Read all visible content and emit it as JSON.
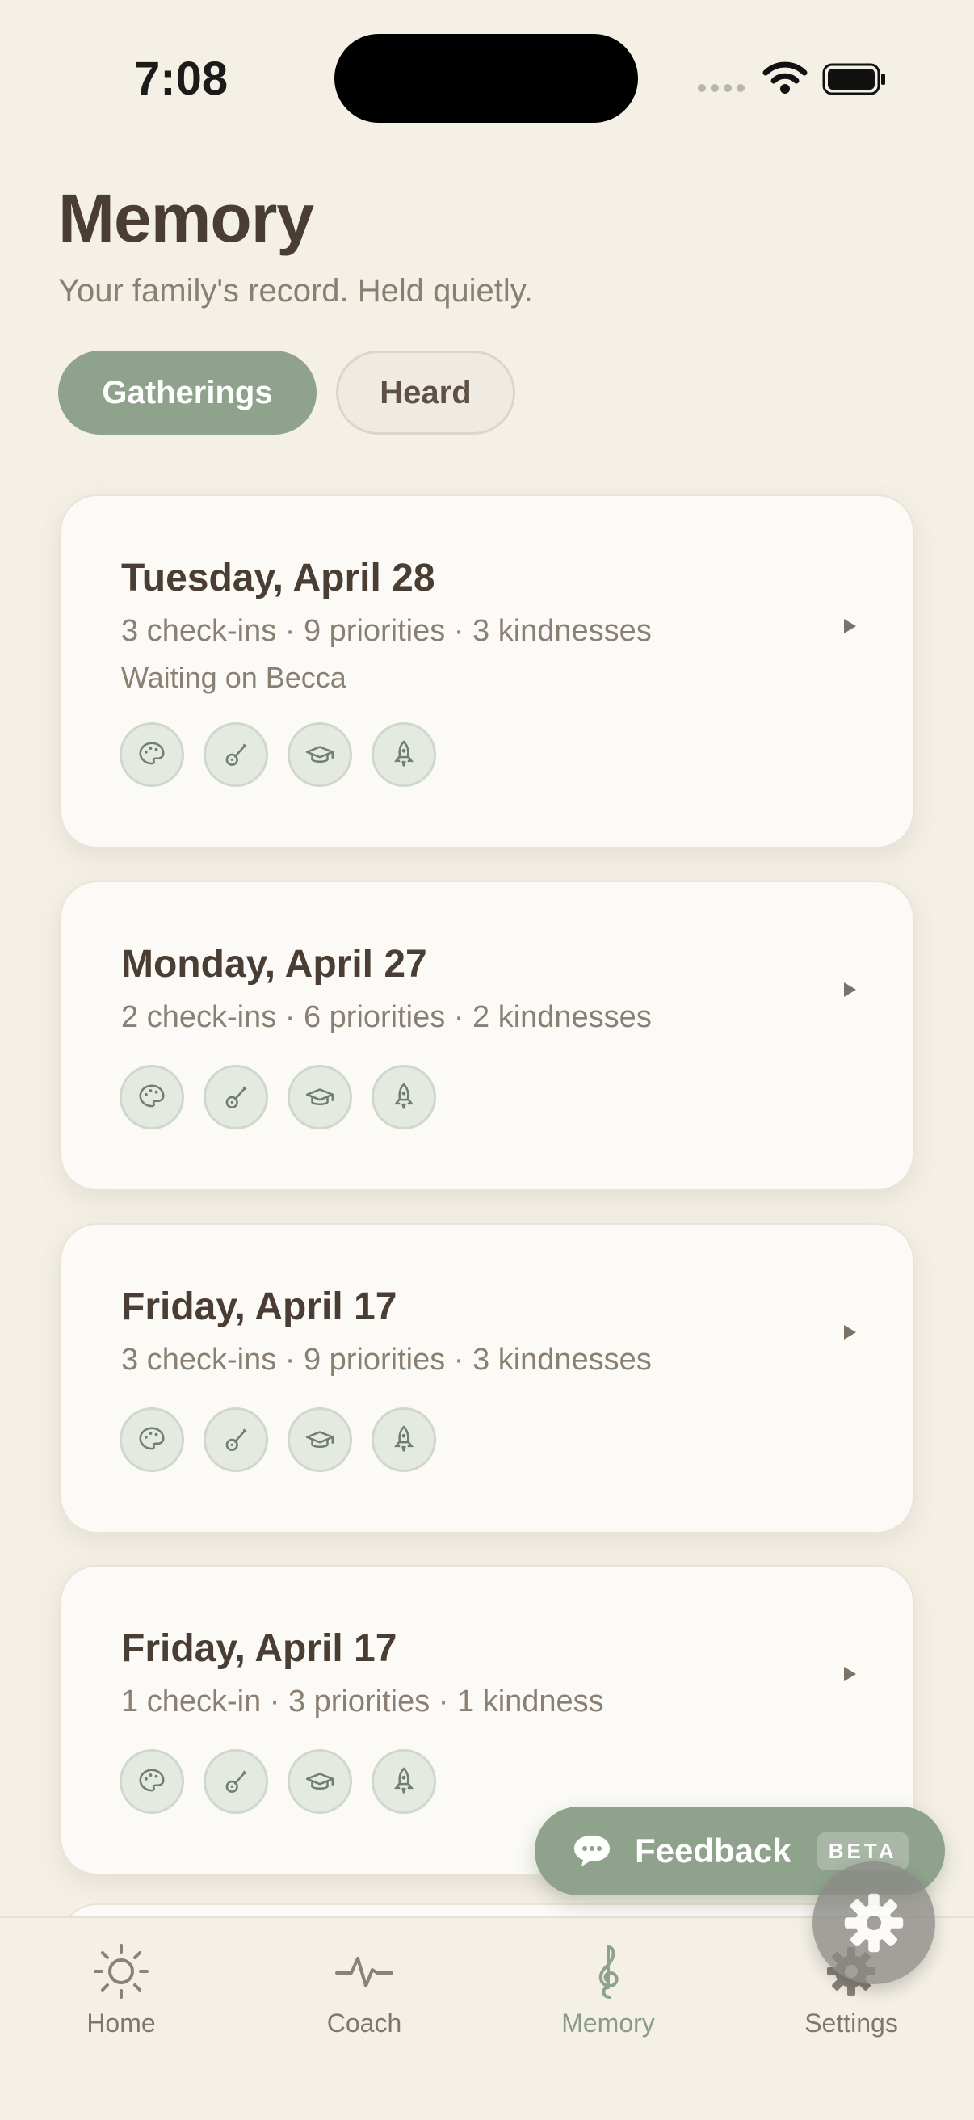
{
  "status": {
    "time": "7:08"
  },
  "header": {
    "title": "Memory",
    "subtitle": "Your family's record. Held quietly."
  },
  "segments": [
    {
      "label": "Gatherings",
      "active": true
    },
    {
      "label": "Heard",
      "active": false
    }
  ],
  "cards": [
    {
      "date": "Tuesday, April 28",
      "meta": "3 check-ins · 9 priorities · 3 kindnesses",
      "note": "Waiting on Becca"
    },
    {
      "date": "Monday, April 27",
      "meta": "2 check-ins · 6 priorities · 2 kindnesses"
    },
    {
      "date": "Friday, April 17",
      "meta": "3 check-ins · 9 priorities · 3 kindnesses"
    },
    {
      "date": "Friday, April 17",
      "meta": "1 check-in · 3 priorities · 1 kindness"
    }
  ],
  "card_icons": [
    "palette-icon",
    "guitar-icon",
    "graduation-cap-icon",
    "rocket-icon"
  ],
  "feedback": {
    "label": "Feedback",
    "badge": "BETA"
  },
  "tabs": [
    {
      "label": "Home",
      "icon": "sun-icon"
    },
    {
      "label": "Coach",
      "icon": "pulse-icon"
    },
    {
      "label": "Memory",
      "icon": "treble-clef-icon",
      "active": true
    },
    {
      "label": "Settings",
      "icon": "gear-icon"
    }
  ],
  "colors": {
    "background": "#f4f0e6",
    "accent": "#8fa38c",
    "text": "#4a3d33",
    "muted": "#8a7f73"
  }
}
